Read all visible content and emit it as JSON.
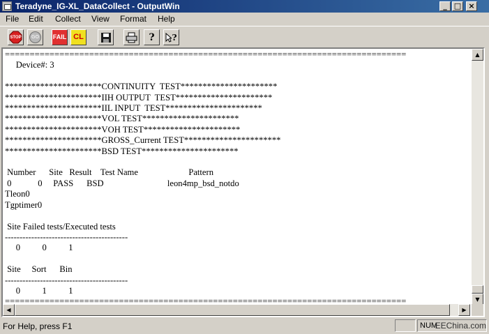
{
  "window": {
    "title": "Teradyne_IG-XL_DataCollect - OutputWin",
    "minimize_glyph": "_",
    "maximize_glyph": "□",
    "close_glyph": "×"
  },
  "menu": [
    "File",
    "Edit",
    "Collect",
    "View",
    "Format",
    "Help"
  ],
  "toolbar": {
    "stop_label": "STOP",
    "go_label": "GO",
    "fail_label": "FAIL",
    "cl_label": "CL",
    "save_icon": "save-icon",
    "print_icon": "print-icon",
    "help_label": "?",
    "context_help_label": "?"
  },
  "output_text": [
    "=================================================================================",
    "     Device#: 3",
    "",
    "**********************CONTINUITY  TEST**********************",
    "**********************IIH OUTPUT  TEST**********************",
    "**********************IIL INPUT  TEST**********************",
    "**********************VOL TEST**********************",
    "**********************VOH TEST**********************",
    "**********************GROSS_Current TEST**********************",
    "**********************BSD TEST**********************",
    "",
    " Number      Site   Result    Test Name                       Pattern",
    " 0            0     PASS      BSD                             leon4mp_bsd_notdo",
    "Tleon0",
    "Tgptimer0",
    "",
    " Site Failed tests/Executed tests",
    "------------------------------------------",
    "     0          0          1",
    "",
    " Site     Sort      Bin",
    "------------------------------------------",
    "     0          1          1",
    "================================================================================="
  ],
  "status": {
    "help_text": "For Help, press F1",
    "num_indicator": "NUM",
    "watermark": "EEChina.com"
  }
}
